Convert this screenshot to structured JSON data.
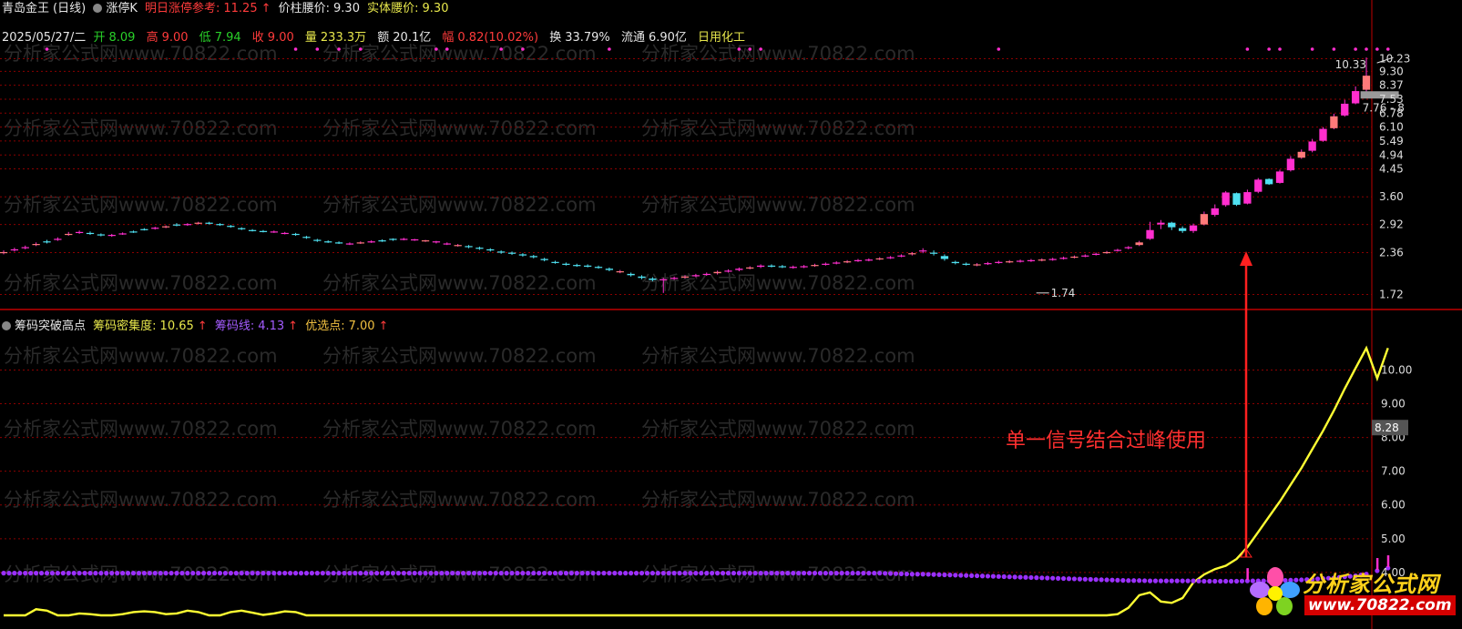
{
  "header": {
    "stock_name": "青岛金王",
    "period": "(日线)",
    "indicator_name": "涨停K",
    "next_limit_label": "明日涨停参考:",
    "next_limit_value": "11.25",
    "up_arrow": "↑",
    "waist_price_label": "价柱腰价:",
    "waist_price_value": "9.30",
    "body_waist_label": "实体腰价:",
    "body_waist_value": "9.30"
  },
  "quote": {
    "date": "2025/05/27/二",
    "open_label": "开",
    "open": "8.09",
    "high_label": "高",
    "high": "9.00",
    "low_label": "低",
    "low": "7.94",
    "close_label": "收",
    "close": "9.00",
    "volume_label": "量",
    "volume": "233.3万",
    "amount_label": "额",
    "amount": "20.1亿",
    "change_label": "幅",
    "change": "0.82(10.02%)",
    "turnover_label": "换",
    "turnover": "33.79%",
    "float_label": "流通",
    "float": "6.90亿",
    "sector": "日用化工"
  },
  "sub_header": {
    "indicator_name": "筹码突破高点",
    "density_label": "筹码密集度:",
    "density_value": "10.65",
    "chip_label": "筹码线:",
    "chip_value": "4.13",
    "select_label": "优选点:",
    "select_value": "7.00",
    "up_arrow": "↑"
  },
  "annotation": "单一信号结合过峰使用",
  "watermark": "分析家公式网www.70822.com",
  "logo": {
    "title": "分析家公式网",
    "url": "www.70822.com"
  },
  "colors": {
    "background": "#000000",
    "up": "#ff2ecf",
    "down": "#4fe0f0",
    "chip_line": "#9b30ff",
    "density_line": "#ffff33",
    "grid": "#8b0000",
    "annotation": "#ff2020"
  },
  "chart_data": [
    {
      "type": "candlestick",
      "title": "涨停K",
      "axis": "log",
      "ylim": [
        1.6,
        11.0
      ],
      "yticks": [
        1.72,
        2.36,
        2.92,
        3.6,
        4.45,
        4.94,
        5.49,
        6.1,
        6.78,
        7.53,
        8.37,
        9.3,
        10.23
      ],
      "annotations": [
        {
          "label": "1.74",
          "kind": "low_marker",
          "index": 97
        },
        {
          "label": "10.33",
          "kind": "high_marker",
          "index": 129
        },
        {
          "label": "7.76 - 8",
          "kind": "price_zone",
          "index": 129
        }
      ],
      "close": [
        2.37,
        2.42,
        2.46,
        2.52,
        2.55,
        2.62,
        2.72,
        2.76,
        2.72,
        2.69,
        2.7,
        2.73,
        2.76,
        2.8,
        2.85,
        2.88,
        2.9,
        2.93,
        2.96,
        2.94,
        2.91,
        2.87,
        2.82,
        2.79,
        2.77,
        2.77,
        2.74,
        2.7,
        2.64,
        2.58,
        2.56,
        2.54,
        2.53,
        2.55,
        2.57,
        2.58,
        2.6,
        2.62,
        2.61,
        2.59,
        2.57,
        2.53,
        2.5,
        2.46,
        2.43,
        2.4,
        2.36,
        2.34,
        2.31,
        2.28,
        2.23,
        2.19,
        2.16,
        2.14,
        2.13,
        2.11,
        2.07,
        2.05,
        1.99,
        1.95,
        1.92,
        1.93,
        1.95,
        1.97,
        1.99,
        2.01,
        2.04,
        2.06,
        2.09,
        2.11,
        2.14,
        2.13,
        2.12,
        2.12,
        2.13,
        2.15,
        2.17,
        2.19,
        2.21,
        2.23,
        2.24,
        2.26,
        2.28,
        2.31,
        2.35,
        2.4,
        2.34,
        2.25,
        2.18,
        2.16,
        2.16,
        2.18,
        2.2,
        2.21,
        2.22,
        2.23,
        2.24,
        2.25,
        2.27,
        2.29,
        2.31,
        2.34,
        2.37,
        2.41,
        2.46,
        2.55,
        2.8,
        2.96,
        2.86,
        2.78,
        2.9,
        3.16,
        3.3,
        3.72,
        3.39,
        3.73,
        4.1,
        3.96,
        4.36,
        4.8,
        5.06,
        5.47,
        6.02,
        6.62,
        7.28,
        8.01,
        9.0
      ],
      "open": [
        2.36,
        2.4,
        2.44,
        2.5,
        2.57,
        2.6,
        2.7,
        2.75,
        2.74,
        2.71,
        2.68,
        2.72,
        2.77,
        2.82,
        2.83,
        2.86,
        2.92,
        2.91,
        2.94,
        2.96,
        2.93,
        2.89,
        2.84,
        2.8,
        2.78,
        2.76,
        2.73,
        2.72,
        2.66,
        2.6,
        2.57,
        2.55,
        2.52,
        2.54,
        2.56,
        2.59,
        2.62,
        2.61,
        2.6,
        2.58,
        2.55,
        2.52,
        2.49,
        2.48,
        2.45,
        2.42,
        2.38,
        2.36,
        2.33,
        2.3,
        2.25,
        2.2,
        2.17,
        2.15,
        2.14,
        2.12,
        2.09,
        2.04,
        2.01,
        1.97,
        1.94,
        1.92,
        1.94,
        1.96,
        1.98,
        2.0,
        2.02,
        2.05,
        2.07,
        2.1,
        2.12,
        2.14,
        2.13,
        2.11,
        2.12,
        2.14,
        2.16,
        2.18,
        2.2,
        2.22,
        2.23,
        2.25,
        2.27,
        2.3,
        2.33,
        2.38,
        2.36,
        2.3,
        2.2,
        2.17,
        2.15,
        2.17,
        2.19,
        2.2,
        2.21,
        2.22,
        2.23,
        2.24,
        2.26,
        2.28,
        2.3,
        2.33,
        2.36,
        2.4,
        2.44,
        2.5,
        2.62,
        2.92,
        2.96,
        2.84,
        2.78,
        2.92,
        3.14,
        3.38,
        3.7,
        3.42,
        3.74,
        4.12,
        4.0,
        4.4,
        4.84,
        5.1,
        5.5,
        6.05,
        6.66,
        7.3,
        8.09
      ],
      "high": [
        2.4,
        2.45,
        2.49,
        2.55,
        2.6,
        2.65,
        2.76,
        2.79,
        2.77,
        2.73,
        2.72,
        2.75,
        2.79,
        2.84,
        2.87,
        2.9,
        2.95,
        2.95,
        2.98,
        2.98,
        2.95,
        2.91,
        2.86,
        2.82,
        2.8,
        2.79,
        2.76,
        2.74,
        2.68,
        2.62,
        2.59,
        2.57,
        2.55,
        2.57,
        2.59,
        2.61,
        2.63,
        2.64,
        2.62,
        2.6,
        2.58,
        2.55,
        2.52,
        2.5,
        2.47,
        2.44,
        2.4,
        2.38,
        2.35,
        2.32,
        2.27,
        2.22,
        2.19,
        2.17,
        2.16,
        2.14,
        2.11,
        2.07,
        2.03,
        1.99,
        1.96,
        1.95,
        1.97,
        1.99,
        2.01,
        2.03,
        2.06,
        2.08,
        2.11,
        2.13,
        2.16,
        2.16,
        2.15,
        2.14,
        2.15,
        2.17,
        2.19,
        2.21,
        2.23,
        2.25,
        2.26,
        2.28,
        2.3,
        2.33,
        2.37,
        2.44,
        2.4,
        2.33,
        2.22,
        2.19,
        2.18,
        2.2,
        2.22,
        2.23,
        2.24,
        2.25,
        2.26,
        2.27,
        2.29,
        2.31,
        2.33,
        2.36,
        2.39,
        2.43,
        2.48,
        2.58,
        2.98,
        3.02,
        2.98,
        2.88,
        2.94,
        3.22,
        3.4,
        3.76,
        3.72,
        3.8,
        4.15,
        4.14,
        4.42,
        4.9,
        5.15,
        5.58,
        6.1,
        6.75,
        7.5,
        8.3,
        10.33
      ],
      "low": [
        2.33,
        2.38,
        2.42,
        2.48,
        2.53,
        2.58,
        2.68,
        2.72,
        2.7,
        2.67,
        2.66,
        2.7,
        2.74,
        2.79,
        2.81,
        2.84,
        2.88,
        2.89,
        2.92,
        2.92,
        2.89,
        2.85,
        2.8,
        2.77,
        2.75,
        2.74,
        2.71,
        2.68,
        2.62,
        2.56,
        2.54,
        2.52,
        2.5,
        2.52,
        2.54,
        2.56,
        2.58,
        2.59,
        2.58,
        2.56,
        2.53,
        2.5,
        2.47,
        2.44,
        2.41,
        2.38,
        2.34,
        2.32,
        2.29,
        2.26,
        2.21,
        2.17,
        2.14,
        2.12,
        2.11,
        2.09,
        2.05,
        2.02,
        1.97,
        1.93,
        1.9,
        1.74,
        1.92,
        1.94,
        1.96,
        1.98,
        2.0,
        2.03,
        2.05,
        2.08,
        2.1,
        2.11,
        2.1,
        2.09,
        2.1,
        2.12,
        2.14,
        2.16,
        2.18,
        2.2,
        2.21,
        2.23,
        2.25,
        2.28,
        2.31,
        2.35,
        2.31,
        2.22,
        2.16,
        2.14,
        2.13,
        2.15,
        2.17,
        2.18,
        2.19,
        2.2,
        2.21,
        2.22,
        2.24,
        2.26,
        2.28,
        2.31,
        2.34,
        2.38,
        2.42,
        2.48,
        2.6,
        2.82,
        2.8,
        2.74,
        2.74,
        2.9,
        3.1,
        3.34,
        3.36,
        3.4,
        3.7,
        3.94,
        3.98,
        4.36,
        4.8,
        5.04,
        5.46,
        6.0,
        6.6,
        7.25,
        7.94
      ]
    },
    {
      "type": "line",
      "title": "筹码突破高点",
      "ylim": [
        3.7,
        11.2
      ],
      "yticks": [
        4.0,
        5.0,
        6.0,
        7.0,
        8.0,
        9.0,
        10.0
      ],
      "current_value_label": "8.28",
      "series": [
        {
          "name": "筹码密集度",
          "values": [
            3.15,
            3.18,
            3.22,
            3.32,
            3.3,
            3.22,
            3.2,
            3.26,
            3.25,
            3.22,
            3.22,
            3.25,
            3.28,
            3.29,
            3.28,
            3.25,
            3.26,
            3.3,
            3.28,
            3.22,
            3.2,
            3.28,
            3.3,
            3.27,
            3.24,
            3.26,
            3.29,
            3.28,
            3.2,
            3.12,
            3.16,
            3.14,
            3.12,
            3.15,
            3.18,
            3.16,
            3.2,
            3.22,
            3.21,
            3.18,
            3.2,
            3.22,
            3.23,
            3.22,
            3.2,
            3.16,
            3.14,
            3.13,
            3.12,
            3.1,
            3.07,
            3.05,
            3.04,
            3.02,
            3.02,
            3.02,
            3.01,
            2.98,
            2.96,
            2.95,
            2.98,
            2.96,
            2.95,
            2.96,
            2.95,
            2.96,
            2.98,
            2.97,
            2.98,
            3.0,
            3.02,
            2.99,
            2.96,
            2.95,
            2.97,
            2.98,
            2.99,
            3.0,
            3.0,
            3.01,
            3.02,
            3.02,
            3.03,
            3.02,
            3.04,
            3.1,
            3.06,
            3.02,
            3.0,
            3.01,
            3.0,
            3.02,
            3.04,
            3.04,
            3.03,
            3.04,
            3.05,
            3.05,
            3.04,
            3.06,
            3.08,
            3.1,
            3.16,
            3.25,
            3.34,
            3.52,
            3.56,
            3.43,
            3.41,
            3.48,
            3.7,
            3.94,
            4.1,
            4.2,
            4.4,
            4.75,
            5.2,
            5.65,
            6.1,
            6.6,
            7.1,
            7.65,
            8.2,
            8.8,
            9.45,
            10.05,
            10.65,
            9.75,
            10.65
          ]
        },
        {
          "name": "筹码线",
          "values": [
            3.98,
            3.98,
            3.98,
            3.98,
            3.98,
            3.98,
            3.98,
            3.98,
            3.98,
            3.98,
            3.98,
            3.98,
            3.98,
            3.98,
            3.98,
            3.98,
            3.98,
            3.98,
            3.98,
            3.98,
            3.98,
            3.98,
            3.98,
            3.98,
            3.98,
            3.98,
            3.98,
            3.98,
            3.98,
            3.98,
            3.98,
            3.98,
            3.98,
            3.98,
            3.98,
            3.98,
            3.98,
            3.98,
            3.98,
            3.98,
            3.98,
            3.98,
            3.98,
            3.98,
            3.98,
            3.98,
            3.98,
            3.98,
            3.98,
            3.98,
            3.98,
            3.98,
            3.98,
            3.98,
            3.98,
            3.98,
            3.98,
            3.98,
            3.98,
            3.98,
            3.98,
            3.98,
            3.98,
            3.98,
            3.98,
            3.98,
            3.98,
            3.98,
            3.98,
            3.98,
            3.98,
            3.98,
            3.98,
            3.98,
            3.98,
            3.98,
            3.98,
            3.98,
            3.98,
            3.98,
            3.98,
            3.98,
            3.97,
            3.96,
            3.95,
            3.95,
            3.94,
            3.93,
            3.92,
            3.91,
            3.9,
            3.89,
            3.88,
            3.87,
            3.86,
            3.85,
            3.84,
            3.83,
            3.82,
            3.81,
            3.8,
            3.79,
            3.78,
            3.77,
            3.76,
            3.76,
            3.75,
            3.75,
            3.75,
            3.75,
            3.75,
            3.74,
            3.74,
            3.74,
            3.74,
            3.75,
            3.75,
            3.75,
            3.76,
            3.77,
            3.78,
            3.8,
            3.82,
            3.84,
            3.87,
            3.9,
            3.95,
            4.05,
            4.13
          ]
        }
      ]
    }
  ]
}
